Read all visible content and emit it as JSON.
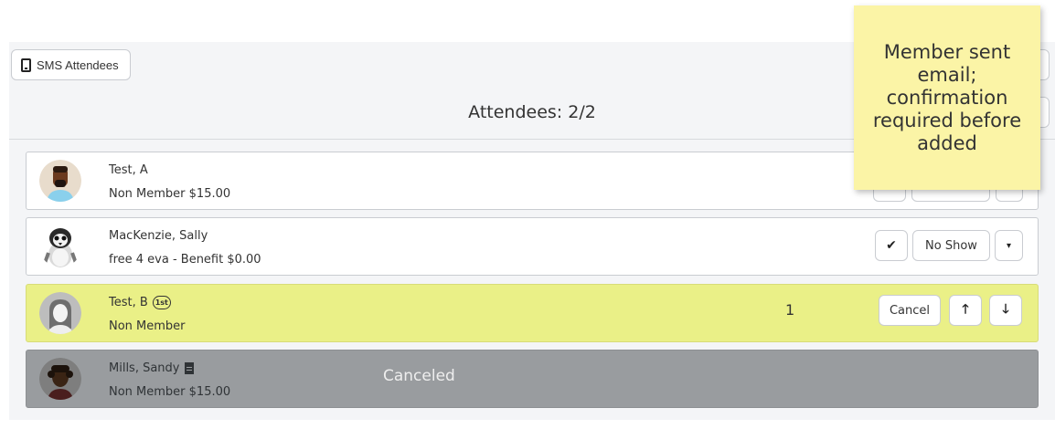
{
  "toolbar": {
    "sms_label": "SMS Attendees"
  },
  "heading": "Attendees: 2/2",
  "sticky_note": "Member sent email; confirmation required before added",
  "attendees": [
    {
      "name": "Test, A",
      "detail": "Non Member $15.00"
    },
    {
      "name": "MacKenzie, Sally",
      "detail": "free 4 eva - Benefit $0.00",
      "noshow_label": "No Show"
    },
    {
      "name": "Test, B",
      "badge": "1st",
      "detail": "Non Member",
      "waitlist_position": "1",
      "cancel_label": "Cancel"
    },
    {
      "name": "Mills, Sandy",
      "detail": "Non Member $15.00",
      "status": "Canceled"
    }
  ],
  "colors": {
    "waitlist_row": "#eaf087",
    "canceled_row": "#999c9f",
    "sticky": "#fbf4a6"
  }
}
